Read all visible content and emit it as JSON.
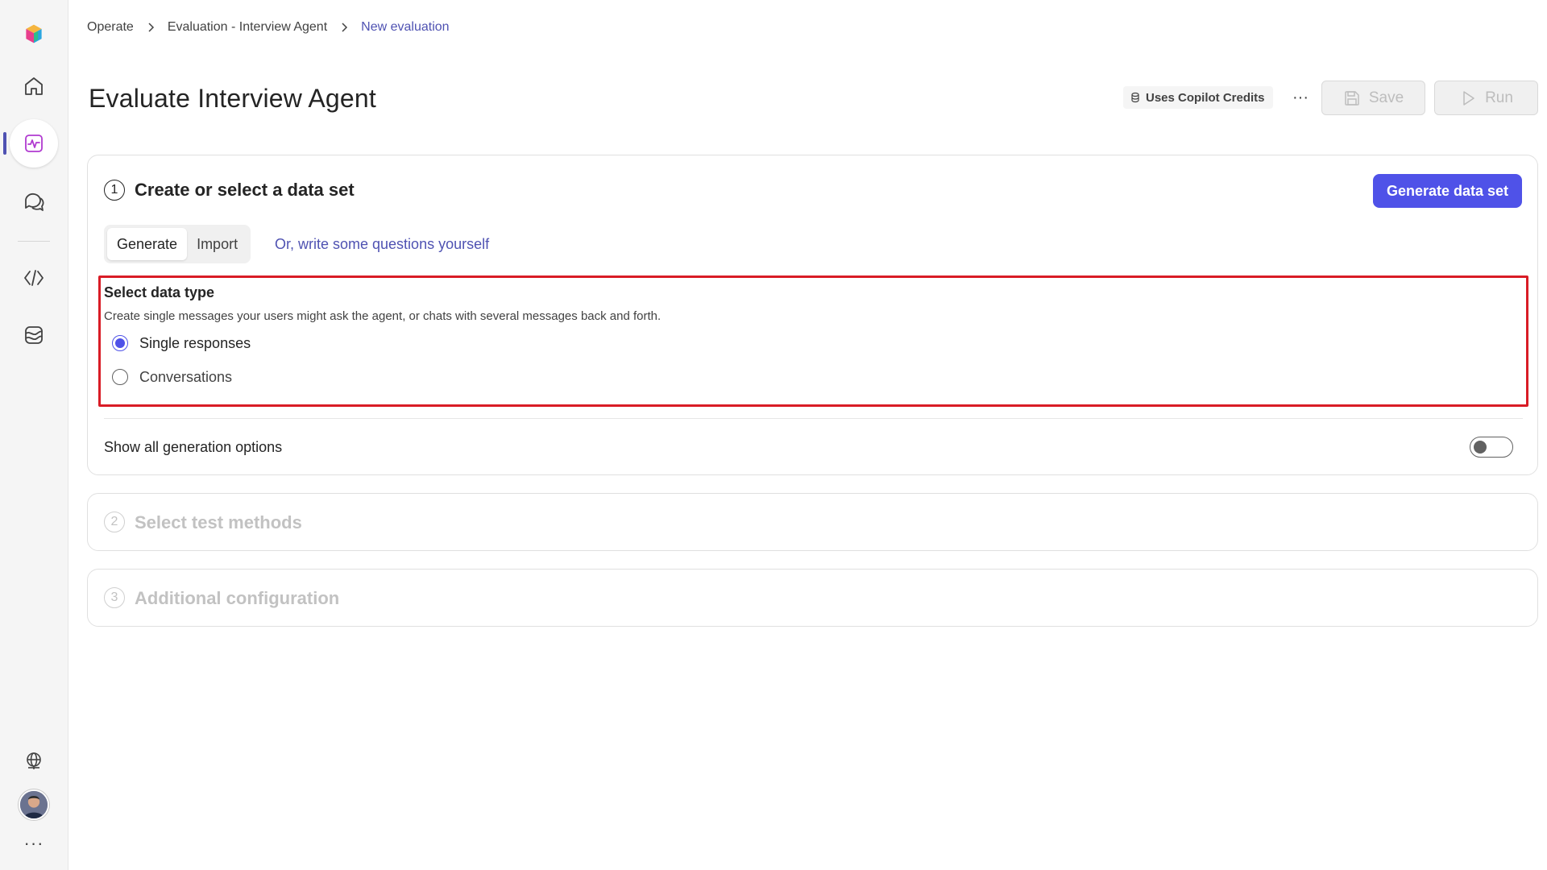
{
  "breadcrumb": {
    "items": [
      "Operate",
      "Evaluation - Interview Agent"
    ],
    "current": "New evaluation"
  },
  "header": {
    "title": "Evaluate Interview Agent",
    "credits_label": "Uses Copilot Credits",
    "more_label": "···",
    "save_label": "Save",
    "run_label": "Run"
  },
  "rail": {
    "icons": [
      "copilot-logo-icon",
      "home-icon",
      "activity-icon",
      "chat-icon",
      "code-icon",
      "knowledge-icon",
      "globe-icon",
      "avatar",
      "more-icon"
    ],
    "more_label": "···",
    "accent": "#4f52b2"
  },
  "section1": {
    "number": "1",
    "title": "Create or select a data set",
    "generate_button": "Generate data set",
    "tabs": [
      "Generate",
      "Import"
    ],
    "selected_tab": "Generate",
    "write_link": "Or, write some questions yourself",
    "data_type": {
      "title": "Select data type",
      "description": "Create single messages your users might ask the agent, or chats with several messages back and forth.",
      "options": [
        "Single responses",
        "Conversations"
      ],
      "selected": "Single responses"
    },
    "show_all_label": "Show all generation options",
    "show_all_enabled": false
  },
  "section2": {
    "number": "2",
    "title": "Select test methods"
  },
  "section3": {
    "number": "3",
    "title": "Additional configuration"
  },
  "colors": {
    "primary": "#4f52e8",
    "link": "#4f52b2",
    "highlight": "#d91c26"
  }
}
